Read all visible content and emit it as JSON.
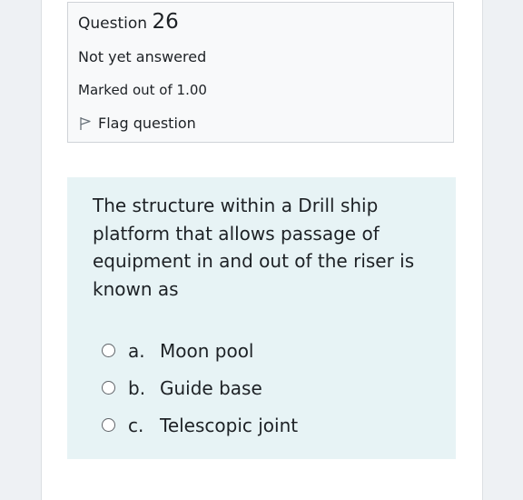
{
  "question_info": {
    "title_prefix": "Question",
    "number": "26",
    "state": "Not yet answered",
    "grade": "Marked out of 1.00",
    "flag_label": "Flag question"
  },
  "question": {
    "text": "The structure within a Drill ship platform that allows passage of equipment in and out of the riser is known as",
    "answers": [
      {
        "letter": "a.",
        "label": "Moon pool"
      },
      {
        "letter": "b.",
        "label": "Guide base"
      },
      {
        "letter": "c.",
        "label": "Telescopic joint"
      }
    ]
  }
}
